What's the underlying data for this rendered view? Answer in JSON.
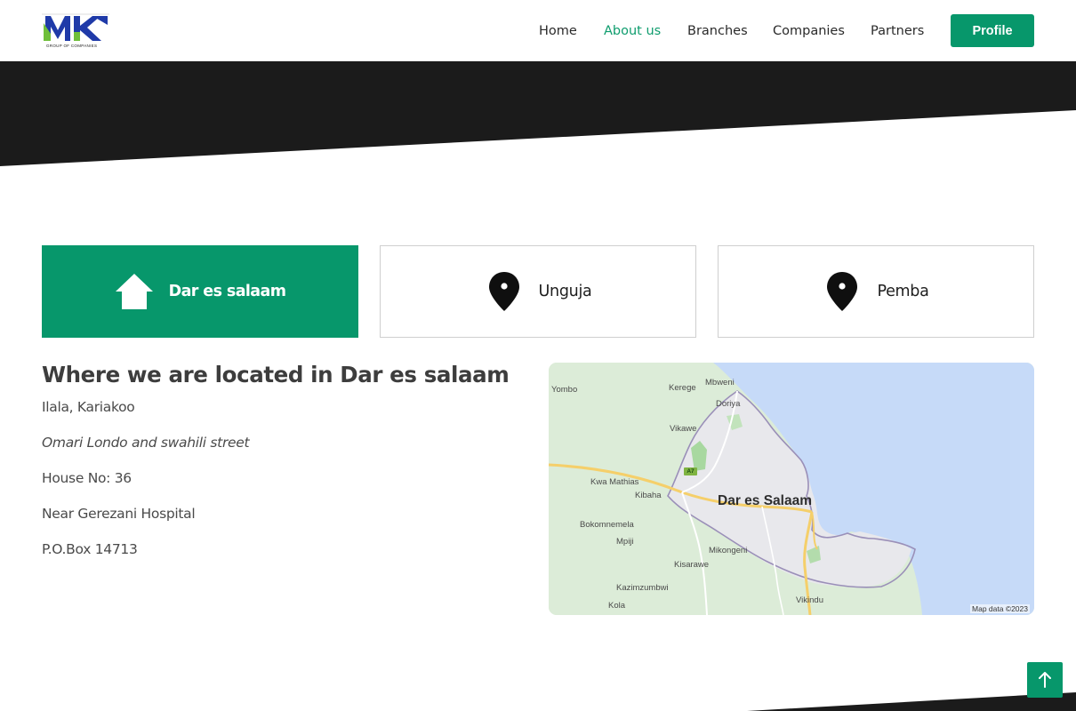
{
  "header": {
    "logo_subtitle": "GROUP OF COMPANIES",
    "nav": [
      {
        "label": "Home",
        "active": false
      },
      {
        "label": "About us",
        "active": true
      },
      {
        "label": "Branches",
        "active": false
      },
      {
        "label": "Companies",
        "active": false
      },
      {
        "label": "Partners",
        "active": false
      }
    ],
    "profile_label": "Profile"
  },
  "tabs": [
    {
      "label": "Dar es salaam",
      "icon": "home-icon",
      "active": true
    },
    {
      "label": "Unguja",
      "icon": "map-pin-icon",
      "active": false
    },
    {
      "label": "Pemba",
      "icon": "map-pin-icon",
      "active": false
    }
  ],
  "location": {
    "title": "Where we are located in Dar es salaam",
    "area": "Ilala, Kariakoo",
    "street": "Omari Londo and swahili street",
    "house": "House No: 36",
    "landmark": "Near Gerezani Hospital",
    "pobox": "P.O.Box 14713"
  },
  "map": {
    "city_label": "Dar es Salaam",
    "places": [
      "Yombo",
      "Kerege",
      "Mbweni",
      "Doriya",
      "Vikawe",
      "Kwa Mathias",
      "Kibaha",
      "Bokomnemela",
      "Mpiji",
      "Mikongeni",
      "Kisarawe",
      "Kazimzumbwi",
      "Kola",
      "Vikindu"
    ],
    "road_badge": "A7",
    "credit": "Map data ©2023"
  },
  "colors": {
    "accent": "#07976b",
    "banner": "#1b1b1b",
    "nav_active": "#0f9d6e"
  },
  "scroll_top_icon": "arrow-up-icon"
}
